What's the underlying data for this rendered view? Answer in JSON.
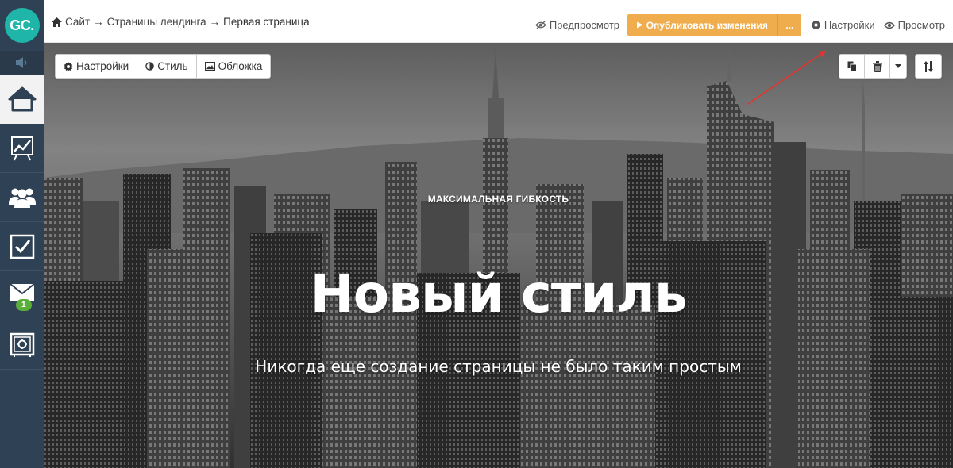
{
  "sidebar": {
    "logo": "GC.",
    "items": [
      {
        "name": "home",
        "icon": "home-icon"
      },
      {
        "name": "stats",
        "icon": "chart-icon"
      },
      {
        "name": "users",
        "icon": "users-icon"
      },
      {
        "name": "tasks",
        "icon": "checkbox-icon"
      },
      {
        "name": "messages",
        "icon": "envelope-icon",
        "badge": "1"
      },
      {
        "name": "safe",
        "icon": "safe-icon"
      }
    ],
    "active_color": "#f2f2f2",
    "bg_color": "#2f4154",
    "logo_color": "#1fb5a8",
    "badge_color": "#5cae3a"
  },
  "breadcrumb": {
    "site": "Сайт",
    "sep": "→",
    "pages": "Страницы лендинга",
    "current": "Первая страница"
  },
  "topbar": {
    "preview_label": "Предпросмотр",
    "publish_label": "Опубликовать изменения",
    "publish_more": "...",
    "settings_label": "Настройки",
    "view_label": "Просмотр",
    "publish_color": "#f0ad4e"
  },
  "block_toolbar": {
    "settings_label": "Настройки",
    "style_label": "Стиль",
    "cover_label": "Обложка"
  },
  "hero": {
    "eyebrow": "МАКСИМАЛЬНАЯ ГИБКОСТЬ",
    "title": "Новый стиль",
    "subtitle": "Никогда еще создание страницы не было таким простым"
  }
}
